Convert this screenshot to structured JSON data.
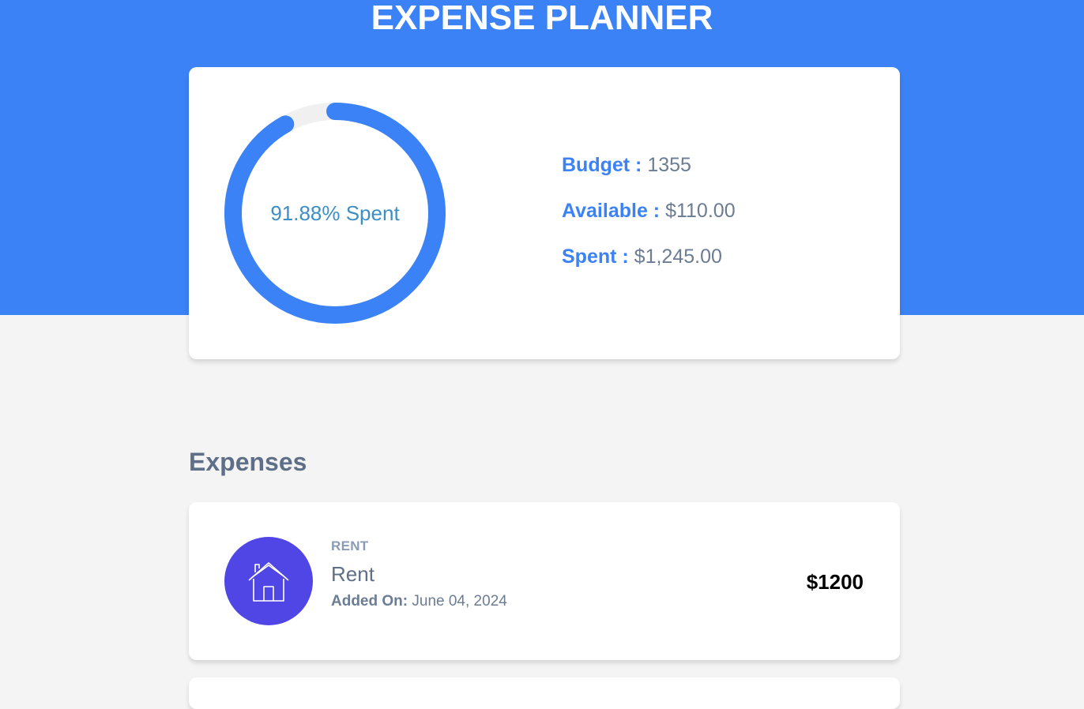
{
  "app": {
    "title": "EXPENSE PLANNER"
  },
  "colors": {
    "accent": "#3b82f6",
    "category_rent": "#4f46e5",
    "ring_track": "#f0f0f0"
  },
  "summary": {
    "percent_spent": 91.88,
    "ring_label": "91.88% Spent",
    "budget_label": "Budget :",
    "budget_value": "1355",
    "available_label": "Available :",
    "available_value": "$110.00",
    "spent_label": "Spent :",
    "spent_value": "$1,245.00"
  },
  "expenses": {
    "section_title": "Expenses",
    "items": [
      {
        "category": "RENT",
        "icon": "house-icon",
        "name": "Rent",
        "added_label": "Added On:",
        "date": "June 04, 2024",
        "amount": "$1200"
      }
    ]
  }
}
